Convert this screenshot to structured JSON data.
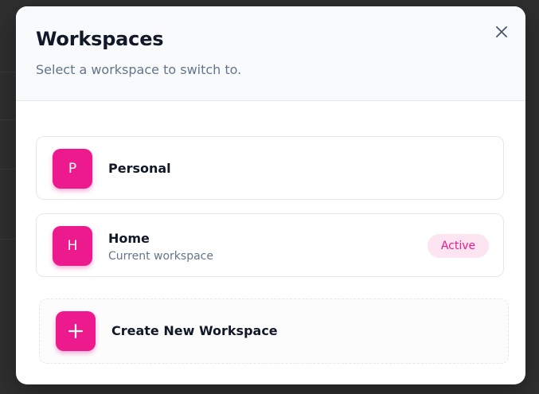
{
  "dialog": {
    "title": "Workspaces",
    "subtitle": "Select a workspace to switch to.",
    "close_icon": "close-icon"
  },
  "workspaces": [
    {
      "initial": "P",
      "name": "Personal",
      "subtitle": "",
      "badge": ""
    },
    {
      "initial": "H",
      "name": "Home",
      "subtitle": "Current workspace",
      "badge": "Active"
    }
  ],
  "create": {
    "label": "Create New Workspace",
    "icon": "plus-icon"
  },
  "colors": {
    "accent": "#ec1a8c",
    "badge_bg": "#fce4f1",
    "header_bg": "#f8fafc",
    "text_primary": "#111827",
    "text_muted": "#64748b",
    "overlay": "#2f2f2f"
  }
}
